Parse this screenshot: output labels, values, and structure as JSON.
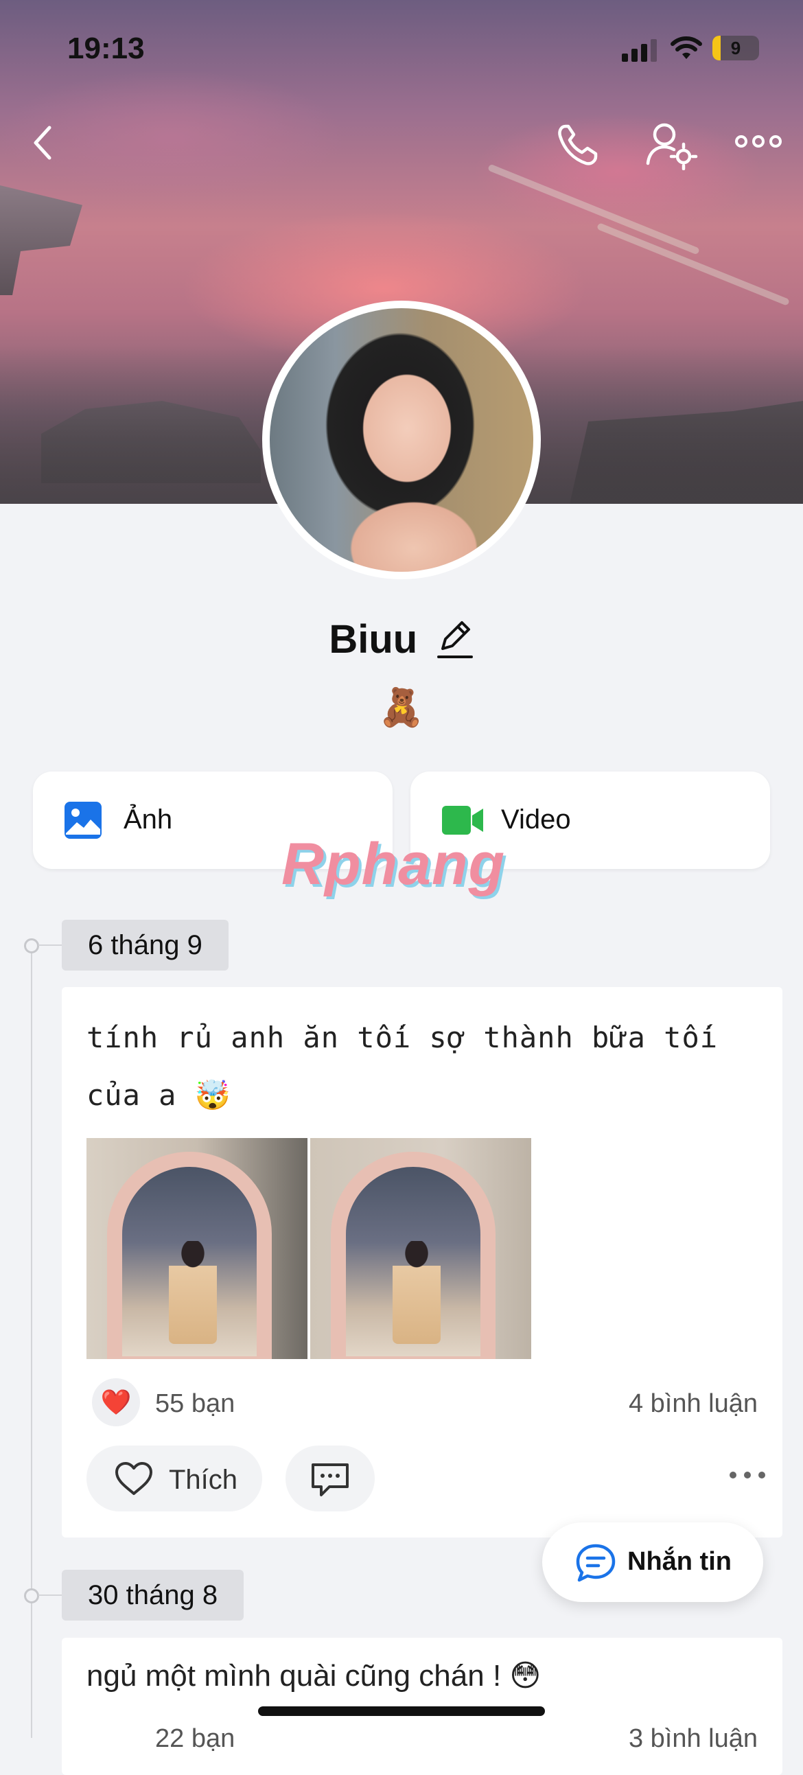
{
  "status_bar": {
    "time": "19:13",
    "battery": "9"
  },
  "header": {
    "back_icon": "chevron-left-icon",
    "call_icon": "phone-icon",
    "settings_icon": "user-gear-icon",
    "more_icon": "more-horizontal-icon"
  },
  "profile": {
    "name": "Biuu",
    "bio": "🧸"
  },
  "shortcuts": [
    {
      "label": "Ảnh",
      "icon": "photo-icon",
      "color": "#1a73e8"
    },
    {
      "label": "Video",
      "icon": "video-camera-icon",
      "color": "#2db84c"
    }
  ],
  "watermark": "Rphang",
  "timeline": [
    {
      "date": "6 tháng 9",
      "text": "tính rủ anh ăn tối sợ thành bữa tối của a 🤯",
      "reaction_emoji": "❤️",
      "likes": "55 bạn",
      "comments": "4 bình luận",
      "like_label": "Thích"
    },
    {
      "date": "30 tháng 8",
      "text": "ngủ một mình quài cũng chán ! 😳",
      "likes": "22 bạn",
      "comments": "3 bình luận"
    }
  ],
  "floating": {
    "message_label": "Nhắn tin"
  },
  "colors": {
    "heart": "#e0243a",
    "accent_blue": "#1a73e8",
    "accent_green": "#2db84c"
  }
}
